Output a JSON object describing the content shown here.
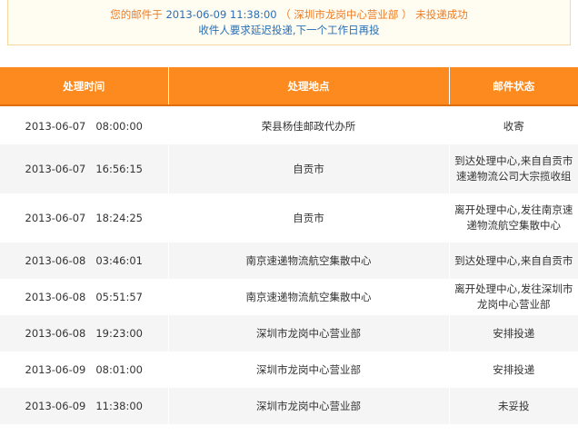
{
  "notice": {
    "prefix": "您的邮件于",
    "time": "2013-06-09 11:38:00",
    "place": "（ 深圳市龙岗中心营业部 ）",
    "suffix": "未投递成功",
    "reason": "收件人要求延迟投递,下一个工作日再投"
  },
  "table": {
    "headers": {
      "time": "处理时间",
      "place": "处理地点",
      "status": "邮件状态"
    },
    "rows": [
      {
        "time": "2013-06-07   08:00:00",
        "place": "荣县杨佳邮政代办所",
        "status": "收寄"
      },
      {
        "time": "2013-06-07   16:56:15",
        "place": "自贡市",
        "status": "到达处理中心,来自自贡市速递物流公司大宗揽收组"
      },
      {
        "time": "2013-06-07   18:24:25",
        "place": "自贡市",
        "status": "离开处理中心,发往南京速递物流航空集散中心"
      },
      {
        "time": "2013-06-08   03:46:01",
        "place": "南京速递物流航空集散中心",
        "status": "到达处理中心,来自自贡市"
      },
      {
        "time": "2013-06-08   05:51:57",
        "place": "南京速递物流航空集散中心",
        "status": "离开处理中心,发往深圳市龙岗中心营业部"
      },
      {
        "time": "2013-06-08   19:23:00",
        "place": "深圳市龙岗中心营业部",
        "status": "安排投递"
      },
      {
        "time": "2013-06-09   08:01:00",
        "place": "深圳市龙岗中心营业部",
        "status": "安排投递"
      },
      {
        "time": "2013-06-09   11:38:00",
        "place": "深圳市龙岗中心营业部",
        "status": "未妥投"
      }
    ]
  },
  "colors": {
    "header_bg": "#fd8a1e",
    "notice_orange": "#ee7d28",
    "notice_blue": "#2a6fb6"
  }
}
